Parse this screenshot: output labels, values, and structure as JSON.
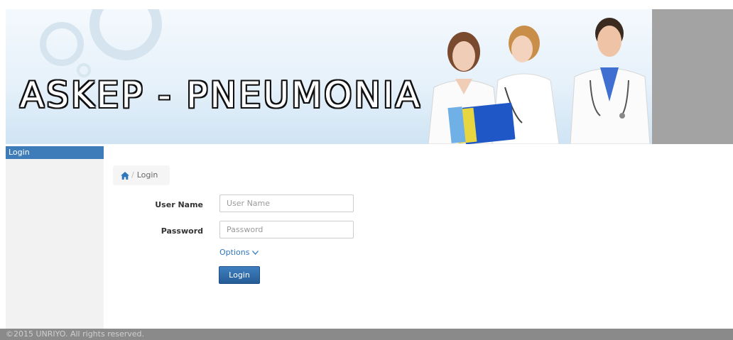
{
  "banner": {
    "title": "ASKEP - PNEUMONIA"
  },
  "sidebar": {
    "items": [
      {
        "label": "Login",
        "active": true
      }
    ]
  },
  "breadcrumb": {
    "icon": "home-icon",
    "label": "Login"
  },
  "form": {
    "username": {
      "label": "User Name",
      "placeholder": "User Name",
      "value": ""
    },
    "password": {
      "label": "Password",
      "placeholder": "Password",
      "value": ""
    },
    "options_label": "Options",
    "submit_label": "Login"
  },
  "footer": {
    "text": "©2015 UNRIYO. All rights reserved."
  },
  "colors": {
    "accent": "#3d7cb8",
    "footer": "#8a8a8a",
    "sidebar": "#f2f2f2"
  }
}
